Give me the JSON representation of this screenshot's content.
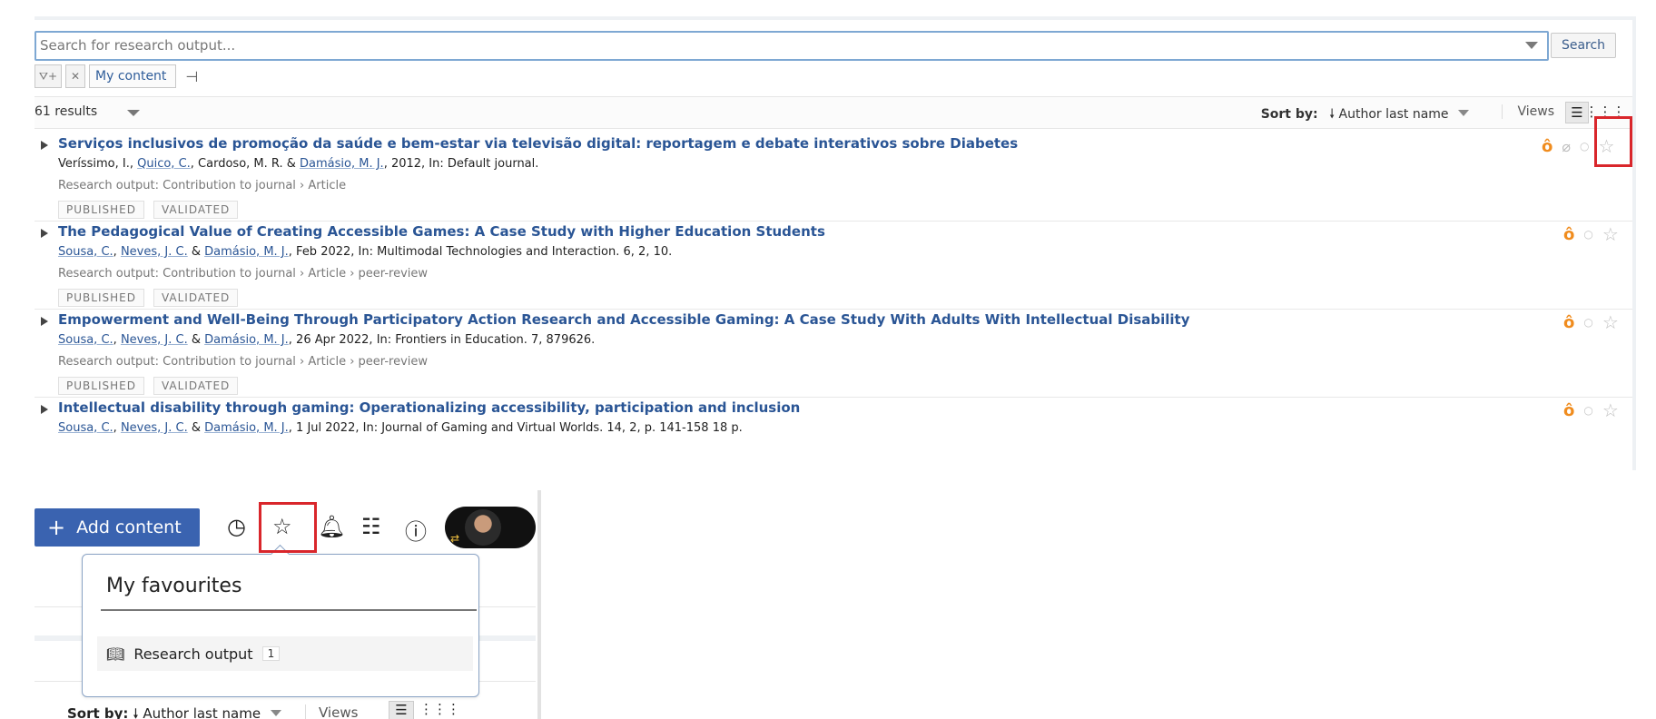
{
  "search": {
    "placeholder": "Search for research output...",
    "button_label": "Search"
  },
  "filters": {
    "add_filter_icon": "funnel-plus-icon",
    "remove_icon": "close-icon",
    "chip_label": "My content",
    "pin_icon": "pin-icon"
  },
  "results_bar": {
    "count": "61 results",
    "sort_label": "Sort by:",
    "sort_value": "Author last name",
    "sort_direction_icon": "arrow-down-icon",
    "views_label": "Views",
    "view_list_icon": "list-icon",
    "view_grid_icon": "grid-icon"
  },
  "results": [
    {
      "title": "Serviços inclusivos de promoção da saúde e bem-estar via televisão digital: reportagem e debate interativos sobre Diabetes",
      "authors": [
        {
          "text": "Veríssimo, I.",
          "link": false
        },
        {
          "text": ", ",
          "link": false
        },
        {
          "text": "Quico, C.",
          "link": true
        },
        {
          "text": ", Cardoso, M. R. & ",
          "link": false
        },
        {
          "text": "Damásio, M. J.",
          "link": true
        },
        {
          "text": ", 2012, In: Default journal.",
          "link": false
        }
      ],
      "type": "Research output: Contribution to journal › Article",
      "tags": [
        "PUBLISHED",
        "VALIDATED"
      ],
      "icons": [
        "open-access-icon",
        "attachment-icon",
        "circle-icon",
        "star-icon"
      ]
    },
    {
      "title": "The Pedagogical Value of Creating Accessible Games: A Case Study with Higher Education Students",
      "authors": [
        {
          "text": "Sousa, C.",
          "link": true
        },
        {
          "text": ", ",
          "link": false
        },
        {
          "text": "Neves, J. C.",
          "link": true
        },
        {
          "text": " & ",
          "link": false
        },
        {
          "text": "Damásio, M. J.",
          "link": true
        },
        {
          "text": ", Feb 2022, In: Multimodal Technologies and Interaction. 6, 2, 10.",
          "link": false
        }
      ],
      "type": "Research output: Contribution to journal › Article › peer-review",
      "tags": [
        "PUBLISHED",
        "VALIDATED"
      ],
      "icons": [
        "open-access-icon",
        "circle-icon",
        "star-icon"
      ]
    },
    {
      "title": "Empowerment and Well-Being Through Participatory Action Research and Accessible Gaming: A Case Study With Adults With Intellectual Disability",
      "authors": [
        {
          "text": "Sousa, C.",
          "link": true
        },
        {
          "text": ", ",
          "link": false
        },
        {
          "text": "Neves, J. C.",
          "link": true
        },
        {
          "text": " & ",
          "link": false
        },
        {
          "text": "Damásio, M. J.",
          "link": true
        },
        {
          "text": ", 26 Apr 2022, In: Frontiers in Education. 7, 879626.",
          "link": false
        }
      ],
      "type": "Research output: Contribution to journal › Article › peer-review",
      "tags": [
        "PUBLISHED",
        "VALIDATED"
      ],
      "icons": [
        "open-access-icon",
        "circle-icon",
        "star-icon"
      ]
    },
    {
      "title": "Intellectual disability through gaming: Operationalizing accessibility, participation and inclusion",
      "authors": [
        {
          "text": "Sousa, C.",
          "link": true
        },
        {
          "text": ", ",
          "link": false
        },
        {
          "text": "Neves, J. C.",
          "link": true
        },
        {
          "text": " & ",
          "link": false
        },
        {
          "text": "Damásio, M. J.",
          "link": true
        },
        {
          "text": ", 1 Jul 2022, In: Journal of Gaming and Virtual Worlds. 14, 2, p. 141-158 18 p.",
          "link": false
        }
      ],
      "type": "",
      "tags": [],
      "icons": [
        "open-access-icon",
        "circle-icon",
        "star-icon"
      ]
    }
  ],
  "header": {
    "add_content_label": "Add content",
    "icons": [
      "history-icon",
      "star-icon",
      "bell-icon",
      "tasks-icon",
      "help-icon"
    ]
  },
  "favourites_popup": {
    "title": "My favourites",
    "item_label": "Research output",
    "item_count": "1",
    "item_icon": "book-icon"
  },
  "bottom_sort": {
    "sort_label": "Sort by:",
    "sort_value": "Author last name",
    "views_label": "Views"
  },
  "colors": {
    "accent": "#3a63b0",
    "link": "#2a5595",
    "open_access": "#f08c1e",
    "highlight": "#d9262b"
  }
}
